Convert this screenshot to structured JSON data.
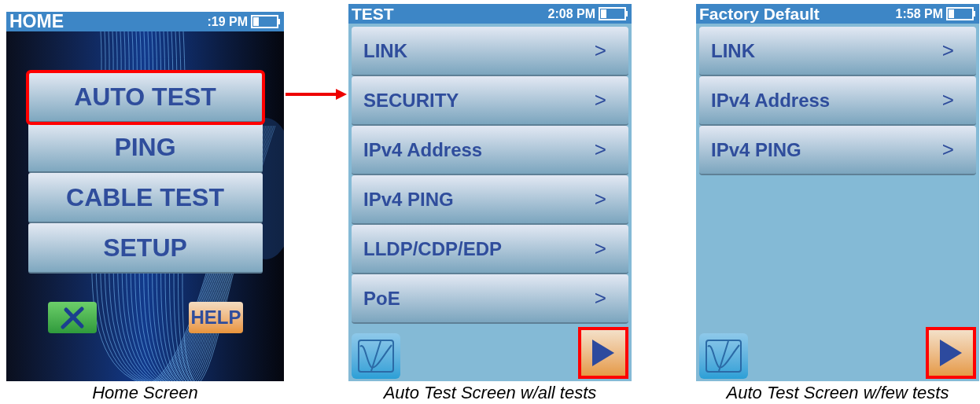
{
  "screens": [
    {
      "kind": "home",
      "title": "HOME",
      "time": ":19 PM",
      "arrow_to_next": true,
      "menu": [
        {
          "label": "AUTO TEST",
          "highlighted": true
        },
        {
          "label": "PING",
          "highlighted": false
        },
        {
          "label": "CABLE TEST",
          "highlighted": false
        },
        {
          "label": "SETUP",
          "highlighted": false
        }
      ],
      "help_label": "HELP",
      "caption": "Home Screen"
    },
    {
      "kind": "test",
      "title": "TEST",
      "time": "2:08 PM",
      "tests": [
        {
          "label": "LINK",
          "chevron": ">"
        },
        {
          "label": "SECURITY",
          "chevron": ">"
        },
        {
          "label": "IPv4 Address",
          "chevron": ">"
        },
        {
          "label": "IPv4 PING",
          "chevron": ">"
        },
        {
          "label": "LLDP/CDP/EDP",
          "chevron": ">"
        },
        {
          "label": "PoE",
          "chevron": ">"
        }
      ],
      "play_highlighted": true,
      "caption": "Auto Test Screen w/all tests"
    },
    {
      "kind": "test",
      "title": "Factory Default",
      "time": "1:58 PM",
      "tests": [
        {
          "label": "LINK",
          "chevron": ">"
        },
        {
          "label": "IPv4 Address",
          "chevron": ">"
        },
        {
          "label": "IPv4 PING",
          "chevron": ">"
        }
      ],
      "play_highlighted": true,
      "caption": "Auto Test Screen w/few tests"
    }
  ]
}
